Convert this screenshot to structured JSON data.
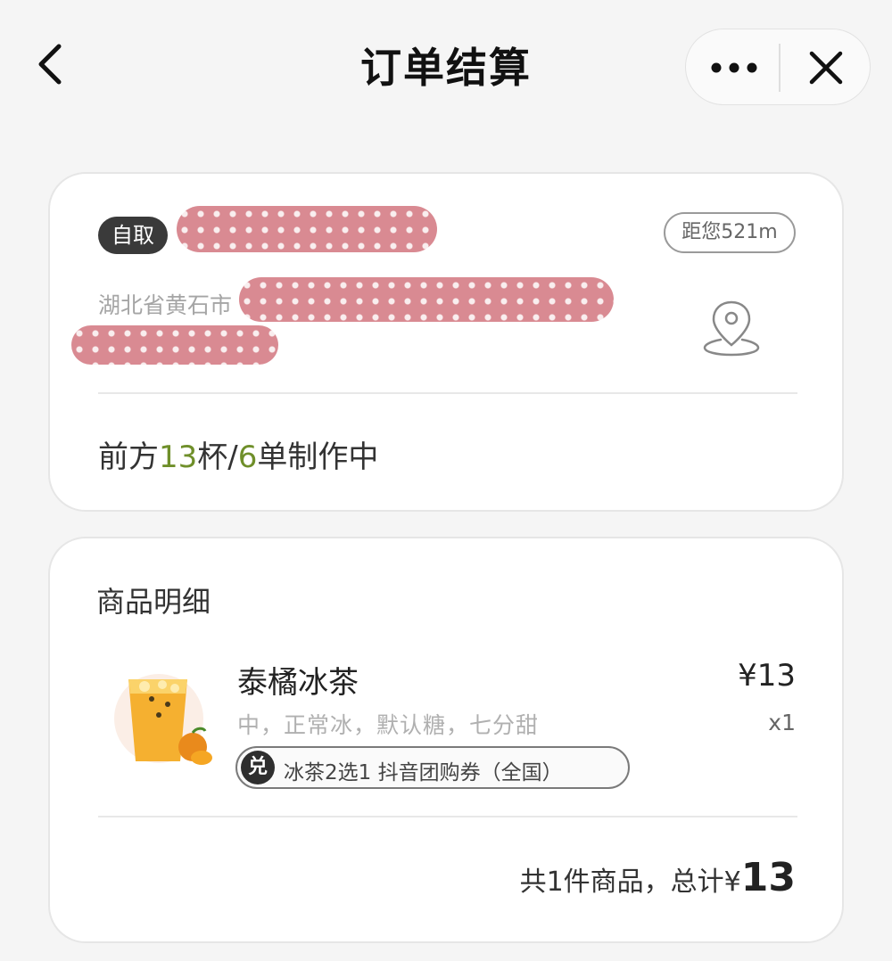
{
  "header": {
    "title": "订单结算",
    "back_icon": "chevron-left-icon",
    "more_icon": "more-dots-icon",
    "close_icon": "close-icon"
  },
  "store": {
    "pickup_label": "自取",
    "distance": "距您521m",
    "address_prefix": "湖北省黄石市",
    "location_icon": "location-pin-icon",
    "queue": {
      "prefix": "前方",
      "cups": "13",
      "cups_unit": "杯/",
      "orders": "6",
      "suffix": "单制作中"
    }
  },
  "items_section": {
    "title": "商品明细",
    "items": [
      {
        "name": "泰橘冰茶",
        "price": "¥13",
        "spec": "中，正常冰，默认糖，七分甜",
        "quantity": "x1",
        "coupon_icon_label": "兑",
        "coupon_text": "冰茶2选1 抖音团购券（全国）"
      }
    ],
    "total_prefix": "共1件商品，总计¥",
    "total_amount": "13"
  },
  "colors": {
    "accent_green": "#6f8f2a",
    "redaction_pink": "#d98a92"
  }
}
